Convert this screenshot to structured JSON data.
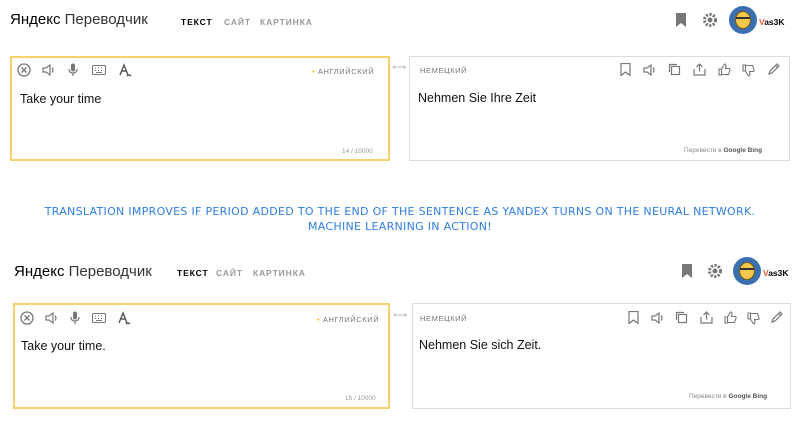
{
  "panels": [
    {
      "logo": {
        "brand": "Яндекс",
        "product": "Переводчик"
      },
      "tabs": [
        {
          "label": "ТЕКСТ"
        },
        {
          "label": "САЙТ"
        },
        {
          "label": "КАРТИНКА"
        }
      ],
      "user": {
        "initial": "V",
        "rest": "as3K"
      },
      "source": {
        "language": "АНГЛИЙСКИЙ",
        "text": "Take your time",
        "counter": "14 / 10000"
      },
      "target": {
        "language": "НЕМЕЦКИЙ",
        "text": "Nehmen Sie Ihre Zeit",
        "powered_prefix": "Перевести в",
        "powered_engines": "Google Bing"
      },
      "swap_symbol": "⟷"
    },
    {
      "logo": {
        "brand": "Яндекс",
        "product": "Переводчик"
      },
      "tabs": [
        {
          "label": "ТЕКСТ"
        },
        {
          "label": "САЙТ"
        },
        {
          "label": "КАРТИНКА"
        }
      ],
      "user": {
        "initial": "V",
        "rest": "as3K"
      },
      "source": {
        "language": "АНГЛИЙСКИЙ",
        "text": "Take your time.",
        "counter": "15 / 10000"
      },
      "target": {
        "language": "НЕМЕЦКИЙ",
        "text": "Nehmen Sie sich Zeit.",
        "powered_prefix": "Перевести в",
        "powered_engines": "Google Bing"
      },
      "swap_symbol": "⟷"
    }
  ],
  "caption": {
    "line1": "TRANSLATION IMPROVES IF PERIOD ADDED TO THE END OF THE SENTENCE AS YANDEX TURNS ON THE NEURAL NETWORK.",
    "line2": "MACHINE LEARNING IN ACTION!"
  },
  "colors": {
    "source_border": "#f5d36a",
    "caption": "#2f7ee0",
    "language_dot": "#f5c400"
  },
  "icons": {
    "source_toolbar": [
      "clear-icon",
      "speaker-icon",
      "microphone-icon",
      "keyboard-icon",
      "handwriting-icon"
    ],
    "target_toolbar": [
      "bookmark-icon",
      "speaker-icon",
      "copy-icon",
      "share-icon",
      "thumbs-up-icon",
      "thumbs-down-icon",
      "edit-icon"
    ],
    "header": [
      "bookmarks-icon",
      "settings-icon",
      "avatar"
    ]
  }
}
